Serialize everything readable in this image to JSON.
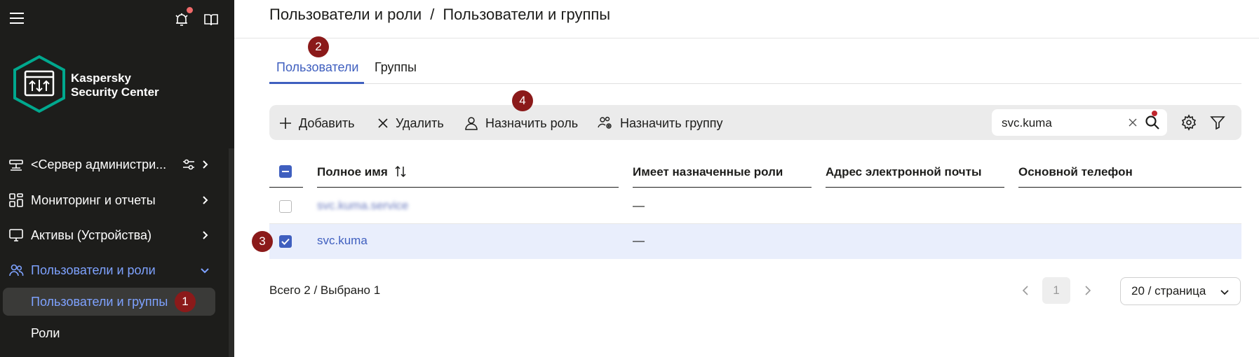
{
  "sidebar": {
    "brand_line1": "Kaspersky",
    "brand_line2": "Security Center",
    "items": [
      {
        "label": "<Сервер администри...",
        "icon": "server-icon"
      },
      {
        "label": "Мониторинг и отчеты",
        "icon": "dashboard-icon"
      },
      {
        "label": "Активы (Устройства)",
        "icon": "monitor-icon"
      },
      {
        "label": "Пользователи и роли",
        "icon": "users-icon"
      }
    ],
    "subitems": [
      {
        "label": "Пользователи и группы"
      },
      {
        "label": "Роли"
      }
    ]
  },
  "breadcrumb": {
    "parent": "Пользователи и роли",
    "separator": "/",
    "current": "Пользователи и группы"
  },
  "tabs": [
    {
      "label": "Пользователи"
    },
    {
      "label": "Группы"
    }
  ],
  "toolbar": {
    "add_label": "Добавить",
    "delete_label": "Удалить",
    "assign_role_label": "Назначить роль",
    "assign_group_label": "Назначить группу",
    "search_value": "svc.kuma"
  },
  "table": {
    "columns": [
      "Полное имя",
      "Имеет назначенные роли",
      "Адрес электронной почты",
      "Основной телефон"
    ],
    "rows": [
      {
        "name": "svc.kuma.service",
        "roles": "—",
        "email": "",
        "phone": "",
        "selected": false
      },
      {
        "name": "svc.kuma",
        "roles": "—",
        "email": "",
        "phone": "",
        "selected": true
      }
    ]
  },
  "footer": {
    "total": "Всего 2 / Выбрано 1",
    "page": "1",
    "page_size": "20 / страница"
  },
  "badges": [
    "1",
    "2",
    "3",
    "4"
  ],
  "colors": {
    "sidebar_bg": "#1d1d1b",
    "accent": "#3f5fbf",
    "badge": "#8b1a1a",
    "selected_row": "#e9eefc"
  }
}
